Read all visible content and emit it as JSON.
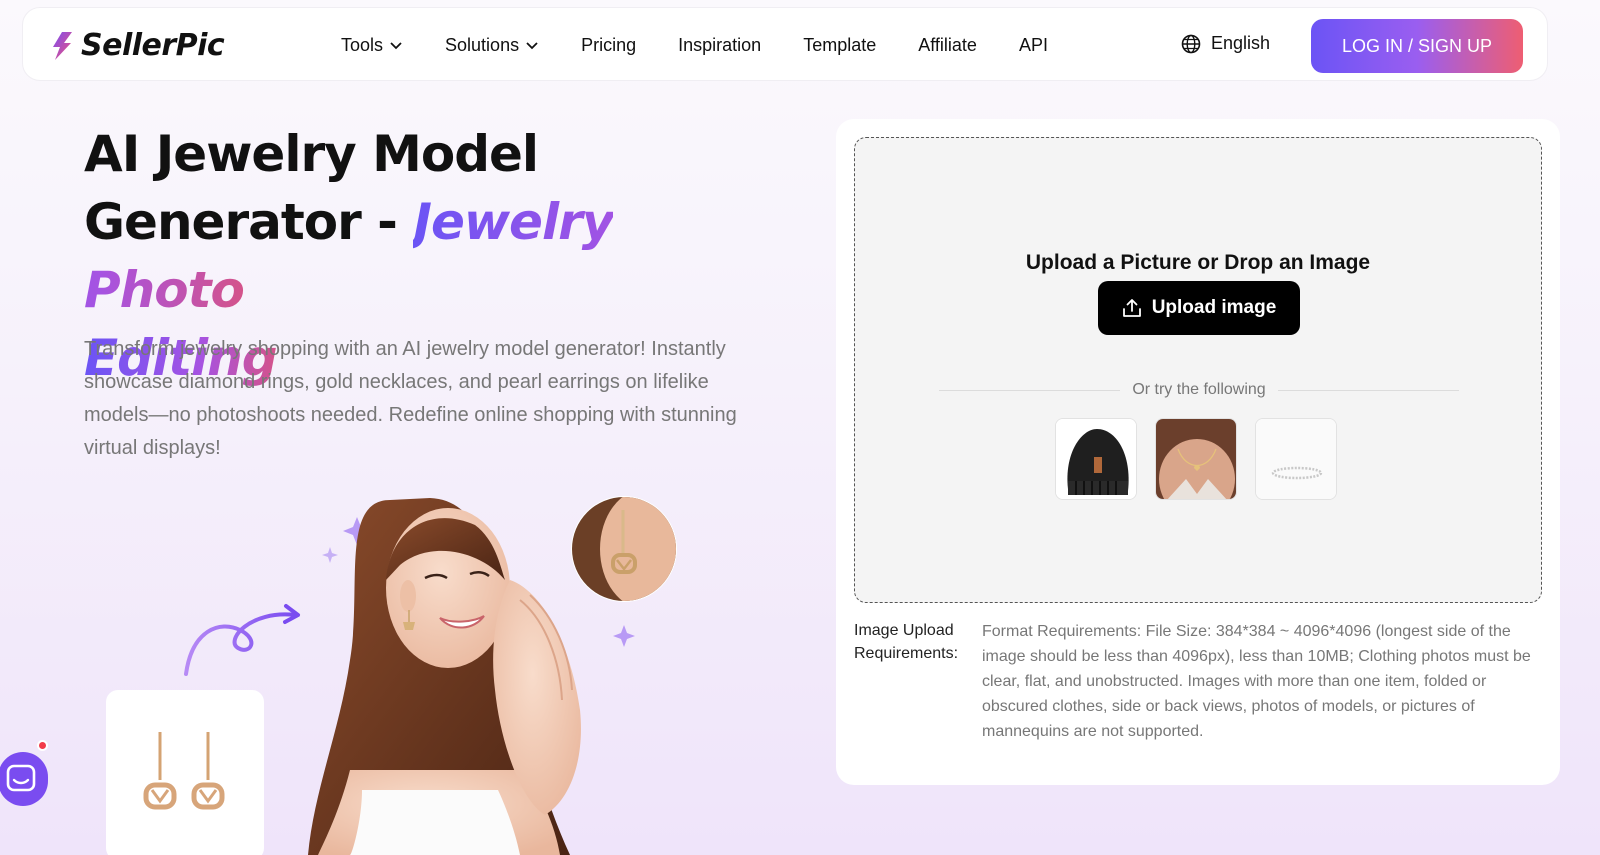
{
  "brand": {
    "name": "SellerPic",
    "logo_icon": "lightning-bolt-logo",
    "colors": {
      "purple": "#6b54f5",
      "pink": "#ee5e72"
    }
  },
  "nav": {
    "items": [
      {
        "label": "Tools",
        "dropdown": true
      },
      {
        "label": "Solutions",
        "dropdown": true
      },
      {
        "label": "Pricing"
      },
      {
        "label": "Inspiration"
      },
      {
        "label": "Template"
      },
      {
        "label": "Affiliate"
      },
      {
        "label": "API"
      }
    ],
    "language": "English",
    "login_label": "LOG IN / SIGN UP"
  },
  "hero": {
    "title_line1": "AI Jewelry Model",
    "title_line2": "Generator - ",
    "title_highlight1": "Jewelry Photo",
    "title_highlight2": "Editing",
    "description": "Transform jewelry shopping with an AI jewelry model generator! Instantly showcase diamond rings, gold necklaces, and pearl earrings on lifelike models—no photoshoots needed. Redefine online shopping with stunning virtual displays!"
  },
  "upload": {
    "title": "Upload a Picture or Drop an Image",
    "button_label": "Upload image",
    "or_text": "Or try the following",
    "samples": [
      "black beanie",
      "heart necklace",
      "silver bracelet"
    ],
    "requirements_label_line1": "Image Upload",
    "requirements_label_line2": "Requirements:",
    "requirements_text": "Format Requirements: File Size: 384*384 ~ 4096*4096 (longest side of the image should be less than 4096px), less than 10MB; Clothing photos must be clear, flat, and unobstructed. Images with more than one item, folded or obscured clothes, side or back views, photos of models, or pictures of mannequins are not supported."
  }
}
